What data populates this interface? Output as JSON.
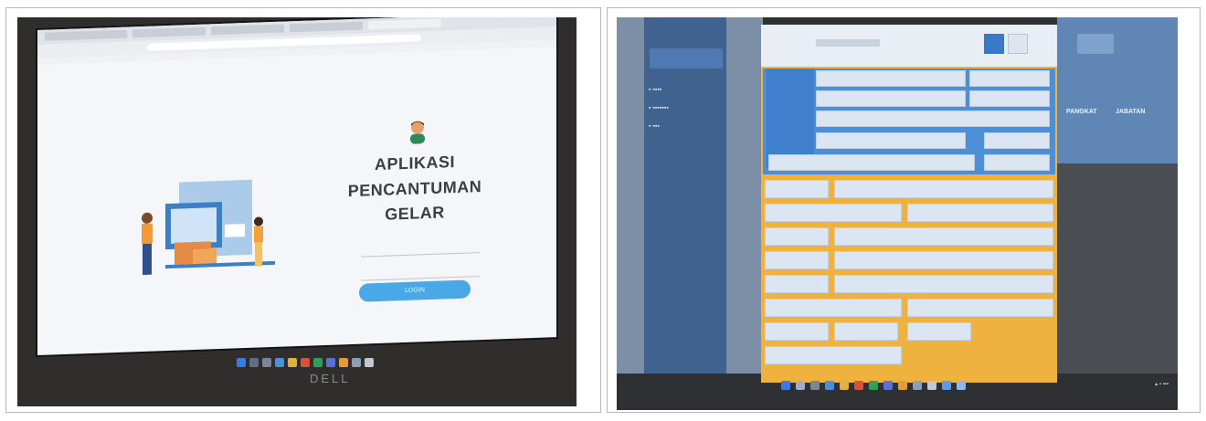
{
  "left_photo": {
    "app_title_lines": [
      "APLIKASI",
      "PENCANTUMAN",
      "GELAR"
    ],
    "login_button_label": "LOGIN",
    "brand": "DELL",
    "colors": {
      "login_button": "#4aa8e6",
      "screen": "#f4f6f9"
    }
  },
  "right_photo": {
    "column_headers": [
      "PANGKAT",
      "JABATAN"
    ],
    "colors": {
      "form_blue": "#4d8fd6",
      "form_orange": "#f0b23f",
      "field": "#dce6f2"
    }
  }
}
